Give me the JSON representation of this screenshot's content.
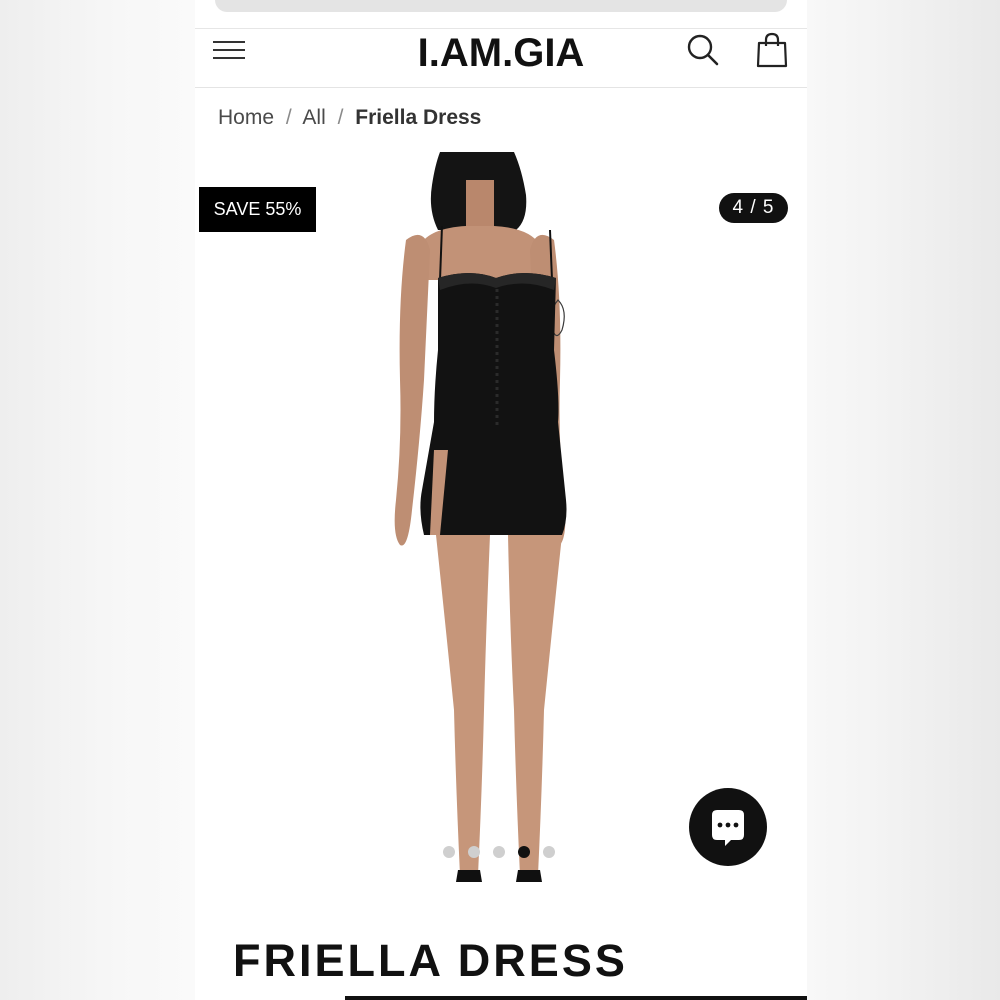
{
  "header": {
    "logo": "I.AM.GIA",
    "menu_icon": "hamburger-menu-icon",
    "search_icon": "search-icon",
    "cart_icon": "shopping-bag-icon"
  },
  "breadcrumb": {
    "items": [
      "Home",
      "All"
    ],
    "current": "Friella Dress",
    "separator": "/"
  },
  "gallery": {
    "badge": "SAVE 55%",
    "counter": "4 / 5",
    "current_index": 4,
    "total": 5
  },
  "chat": {
    "icon": "chat-bubble-icon"
  },
  "product": {
    "title": "FRIELLA DRESS"
  },
  "colors": {
    "accent": "#111111",
    "background": "#ffffff",
    "badge": "#000000"
  }
}
